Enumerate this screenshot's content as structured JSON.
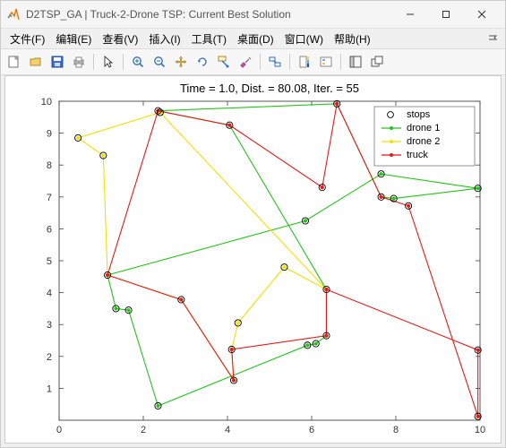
{
  "window": {
    "title": "D2TSP_GA | Truck-2-Drone TSP: Current Best Solution"
  },
  "menu": {
    "file": "文件(F)",
    "edit": "编辑(E)",
    "view": "查看(V)",
    "insert": "插入(I)",
    "tools": "工具(T)",
    "desktop": "桌面(D)",
    "window": "窗口(W)",
    "help": "帮助(H)"
  },
  "chart_data": {
    "type": "scatter",
    "title": "Time = 1.0, Dist. = 80.08, Iter. = 55",
    "xlabel": "",
    "ylabel": "",
    "xlim": [
      0,
      10
    ],
    "ylim": [
      0,
      10
    ],
    "xticks": [
      0,
      2,
      4,
      6,
      8,
      10
    ],
    "yticks": [
      1,
      2,
      3,
      4,
      5,
      6,
      7,
      8,
      9,
      10
    ],
    "legend": {
      "position": "upper-right",
      "entries": [
        "stops",
        "drone 1",
        "drone 2",
        "truck"
      ]
    },
    "stops": [
      [
        0.45,
        8.85
      ],
      [
        1.05,
        8.3
      ],
      [
        1.15,
        4.55
      ],
      [
        1.35,
        3.5
      ],
      [
        1.65,
        3.45
      ],
      [
        2.35,
        0.45
      ],
      [
        2.35,
        9.7
      ],
      [
        2.4,
        9.65
      ],
      [
        2.9,
        3.78
      ],
      [
        4.05,
        9.25
      ],
      [
        4.1,
        2.22
      ],
      [
        4.15,
        1.25
      ],
      [
        4.25,
        3.05
      ],
      [
        5.35,
        4.8
      ],
      [
        5.85,
        6.25
      ],
      [
        5.9,
        2.35
      ],
      [
        6.1,
        2.4
      ],
      [
        6.25,
        7.3
      ],
      [
        6.35,
        2.65
      ],
      [
        6.35,
        4.1
      ],
      [
        6.6,
        9.92
      ],
      [
        7.65,
        7.0
      ],
      [
        7.65,
        7.72
      ],
      [
        7.95,
        6.95
      ],
      [
        8.3,
        6.72
      ],
      [
        9.95,
        0.12
      ],
      [
        9.95,
        2.2
      ],
      [
        9.95,
        7.27
      ]
    ],
    "series": [
      {
        "name": "drone 1",
        "color": "#24c41a",
        "route": [
          [
            6.35,
            4.1
          ],
          [
            6.35,
            2.65
          ],
          [
            6.1,
            2.4
          ],
          [
            5.9,
            2.35
          ],
          [
            2.35,
            0.45
          ],
          [
            1.65,
            3.45
          ],
          [
            1.35,
            3.5
          ],
          [
            1.15,
            4.55
          ],
          [
            5.85,
            6.25
          ],
          [
            7.65,
            7.72
          ],
          [
            9.95,
            7.27
          ],
          [
            7.95,
            6.95
          ],
          [
            7.65,
            7.0
          ],
          [
            6.6,
            9.92
          ],
          [
            2.35,
            9.7
          ],
          [
            4.05,
            9.25
          ],
          [
            6.35,
            4.1
          ]
        ]
      },
      {
        "name": "drone 2",
        "color": "#f0e100",
        "route": [
          [
            6.35,
            4.1
          ],
          [
            5.35,
            4.8
          ],
          [
            4.25,
            3.05
          ],
          [
            4.1,
            2.22
          ],
          [
            4.15,
            1.25
          ],
          [
            2.9,
            3.78
          ],
          [
            1.15,
            4.55
          ],
          [
            1.05,
            8.3
          ],
          [
            0.45,
            8.85
          ],
          [
            2.4,
            9.65
          ],
          [
            6.35,
            4.1
          ]
        ]
      },
      {
        "name": "truck",
        "color": "#ef1515",
        "route": [
          [
            6.35,
            4.1
          ],
          [
            6.35,
            2.65
          ],
          [
            4.1,
            2.22
          ],
          [
            4.15,
            1.25
          ],
          [
            2.9,
            3.78
          ],
          [
            1.15,
            4.55
          ],
          [
            2.35,
            9.7
          ],
          [
            4.05,
            9.25
          ],
          [
            6.25,
            7.3
          ],
          [
            6.6,
            9.92
          ],
          [
            7.65,
            7.0
          ],
          [
            8.3,
            6.72
          ],
          [
            9.95,
            0.12
          ],
          [
            9.95,
            2.2
          ],
          [
            6.35,
            4.1
          ]
        ]
      }
    ]
  }
}
